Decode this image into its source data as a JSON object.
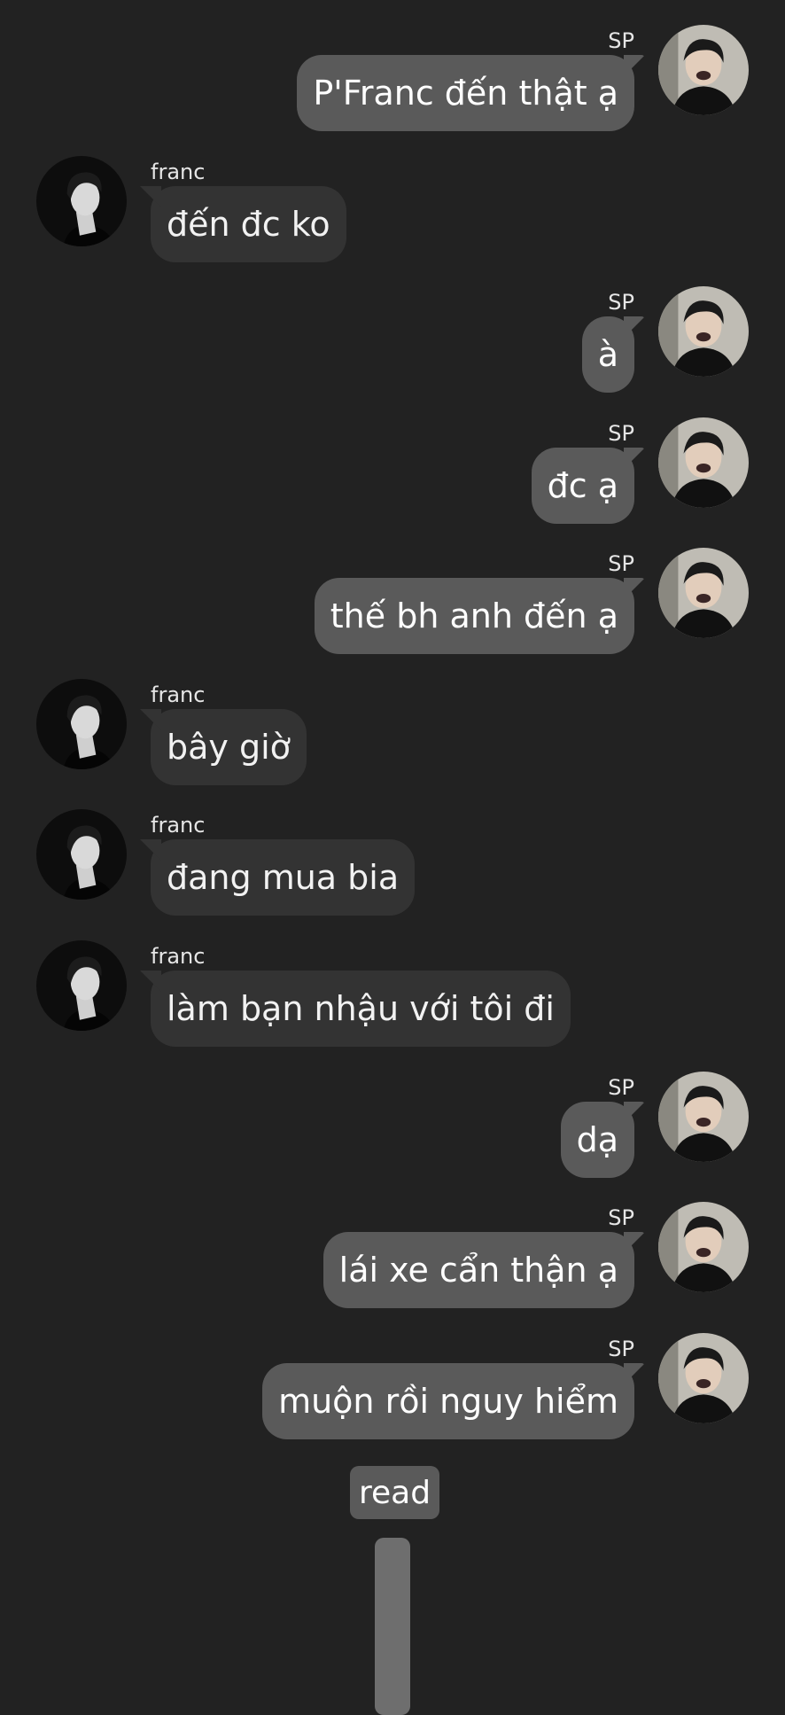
{
  "participants": {
    "self": {
      "name": "SP",
      "avatar_icon": "sp-avatar-icon"
    },
    "other": {
      "name": "franc",
      "avatar_icon": "franc-avatar-icon"
    }
  },
  "colors": {
    "background": "#222222",
    "outgoing_bubble": "#5a5a5a",
    "incoming_bubble": "#333333",
    "text": "#f2f2f2"
  },
  "messages": [
    {
      "direction": "out",
      "sender": "SP",
      "text": "P'Franc đến thật ạ"
    },
    {
      "direction": "in",
      "sender": "franc",
      "text": "đến đc ko"
    },
    {
      "direction": "out",
      "sender": "SP",
      "text": "à"
    },
    {
      "direction": "out",
      "sender": "SP",
      "text": "đc ạ"
    },
    {
      "direction": "out",
      "sender": "SP",
      "text": "thế bh anh đến ạ"
    },
    {
      "direction": "in",
      "sender": "franc",
      "text": "bây giờ"
    },
    {
      "direction": "in",
      "sender": "franc",
      "text": "đang mua bia"
    },
    {
      "direction": "in",
      "sender": "franc",
      "text": "làm bạn nhậu với tôi đi"
    },
    {
      "direction": "out",
      "sender": "SP",
      "text": "dạ"
    },
    {
      "direction": "out",
      "sender": "SP",
      "text": "lái xe cẩn thận ạ"
    },
    {
      "direction": "out",
      "sender": "SP",
      "text": "muộn rồi nguy hiểm"
    }
  ],
  "status": {
    "read_label": "read"
  }
}
